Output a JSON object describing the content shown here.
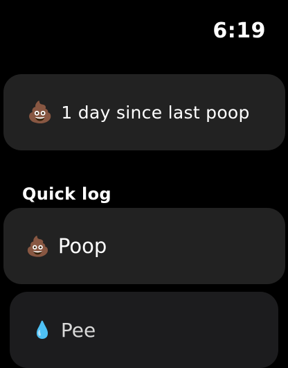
{
  "status": {
    "time": "6:19"
  },
  "summary": {
    "emoji": "💩",
    "text": "1 day since last poop"
  },
  "quick_log": {
    "label": "Quick log",
    "items": [
      {
        "emoji": "💩",
        "label": "Poop"
      },
      {
        "emoji": "💧",
        "label": "Pee"
      }
    ]
  },
  "colors": {
    "background": "#000000",
    "card": "#222222",
    "text": "#ffffff"
  }
}
